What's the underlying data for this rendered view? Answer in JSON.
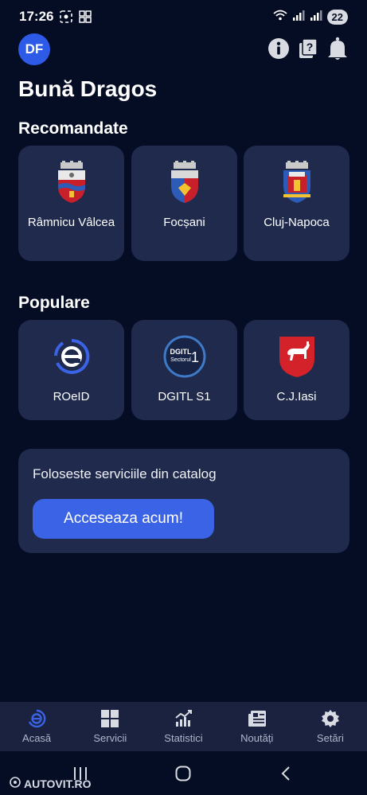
{
  "status_bar": {
    "time": "17:26",
    "battery": "22"
  },
  "header": {
    "avatar_initials": "DF",
    "greeting": "Bună Dragos"
  },
  "recommended": {
    "title": "Recomandate",
    "items": [
      {
        "label": "Râmnicu Vâlcea",
        "icon": "ramnicu-valcea-coat-of-arms-icon"
      },
      {
        "label": "Focșani",
        "icon": "focsani-coat-of-arms-icon"
      },
      {
        "label": "Cluj-Napoca",
        "icon": "cluj-napoca-coat-of-arms-icon"
      }
    ]
  },
  "popular": {
    "title": "Populare",
    "items": [
      {
        "label": "ROeID",
        "icon": "roeid-logo-icon"
      },
      {
        "label": "DGITL S1",
        "icon": "dgitl-sector1-logo-icon",
        "logo_text_top": "DGITL",
        "logo_text_bottom": "Sectorul",
        "logo_number": "1"
      },
      {
        "label": "C.J.Iasi",
        "icon": "iasi-county-coat-of-arms-icon"
      }
    ]
  },
  "catalog": {
    "text": "Foloseste serviciile din catalog",
    "button_label": "Acceseaza acum!"
  },
  "bottom_nav": {
    "items": [
      {
        "label": "Acasă",
        "icon": "home-icon"
      },
      {
        "label": "Servicii",
        "icon": "grid-icon"
      },
      {
        "label": "Statistici",
        "icon": "chart-icon"
      },
      {
        "label": "Noutăți",
        "icon": "news-icon"
      },
      {
        "label": "Setări",
        "icon": "gear-icon"
      }
    ]
  },
  "watermark": "AUTOVIT.RO",
  "colors": {
    "background": "#050d24",
    "card": "#1f2a4c",
    "accent": "#3a63e6",
    "avatar": "#2e5ae8"
  }
}
